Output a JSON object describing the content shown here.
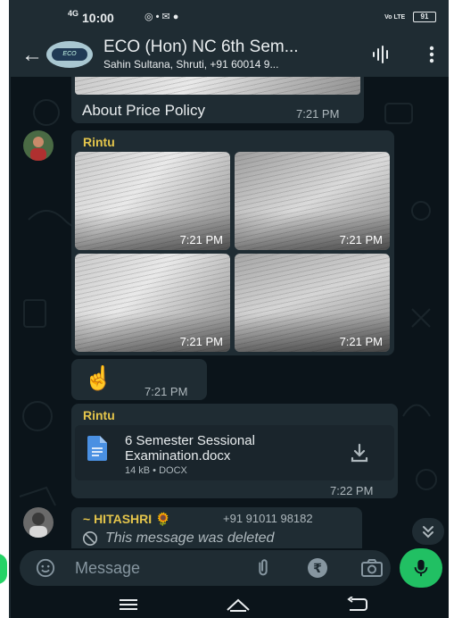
{
  "status_bar": {
    "time": "10:00",
    "signal_label": "4G",
    "indicator_icons": [
      "whatsapp-icon",
      "dot-icon",
      "mail-icon",
      "chat-icon"
    ],
    "right_label": "Vo LTE",
    "battery": "91"
  },
  "header": {
    "title": "ECO (Hon) NC 6th Sem...",
    "subtitle": "Sahin Sultana, Shruti, +91 60014 9..."
  },
  "messages": [
    {
      "type": "image_caption",
      "caption": "About Price Policy",
      "time": "7:21 PM"
    },
    {
      "type": "image_grid",
      "sender": "Rintu",
      "images": [
        {
          "time": "7:21 PM"
        },
        {
          "time": "7:21 PM"
        },
        {
          "time": "7:21 PM"
        },
        {
          "time": "7:21 PM"
        }
      ]
    },
    {
      "type": "emoji",
      "emoji": "☝️",
      "time": "7:21 PM"
    },
    {
      "type": "document",
      "sender": "Rintu",
      "file_name": "6 Semester Sessional Examination.docx",
      "file_name_line1": "6 Semester Sessional",
      "file_name_line2": "Examination.docx",
      "file_meta": "14 kB • DOCX",
      "time": "7:22 PM"
    },
    {
      "type": "deleted",
      "sender": "~ HITASHRI 🌻",
      "phone": "+91 91011 98182",
      "text": "This message was deleted"
    }
  ],
  "composer": {
    "placeholder": "Message"
  },
  "colors": {
    "background": "#0b141a",
    "bubble": "#1f2c33",
    "sender_name": "#e4c54b",
    "accent_green": "#21c063",
    "secondary_text": "#aeb8bd"
  }
}
